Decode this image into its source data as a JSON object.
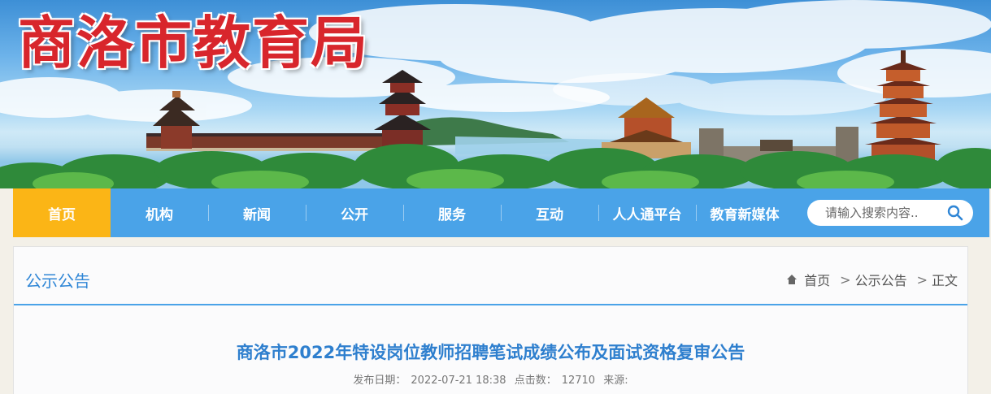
{
  "site": {
    "title": "商洛市教育局"
  },
  "nav": {
    "items": [
      {
        "label": "首页",
        "active": true
      },
      {
        "label": "机构"
      },
      {
        "label": "新闻"
      },
      {
        "label": "公开"
      },
      {
        "label": "服务"
      },
      {
        "label": "互动"
      },
      {
        "label": "人人通平台"
      },
      {
        "label": "教育新媒体"
      }
    ],
    "search_placeholder": "请输入搜索内容..",
    "search_icon": "search-icon"
  },
  "section": {
    "title": "公示公告"
  },
  "breadcrumb": {
    "home_icon": "home-icon",
    "home": "首页",
    "level1": "公示公告",
    "current": "正文",
    "separator": ">"
  },
  "article": {
    "title": "商洛市2022年特设岗位教师招聘笔试成绩公布及面试资格复审公告",
    "date_label": "发布日期：",
    "date": "2022-07-21 18:38",
    "clicks_label": "点击数：",
    "clicks": "12710",
    "source_label": "来源:"
  },
  "colors": {
    "nav_bg": "#4aa3e8",
    "nav_active": "#fbb516",
    "title_red": "#d8262c",
    "accent_blue": "#2e7fce"
  }
}
